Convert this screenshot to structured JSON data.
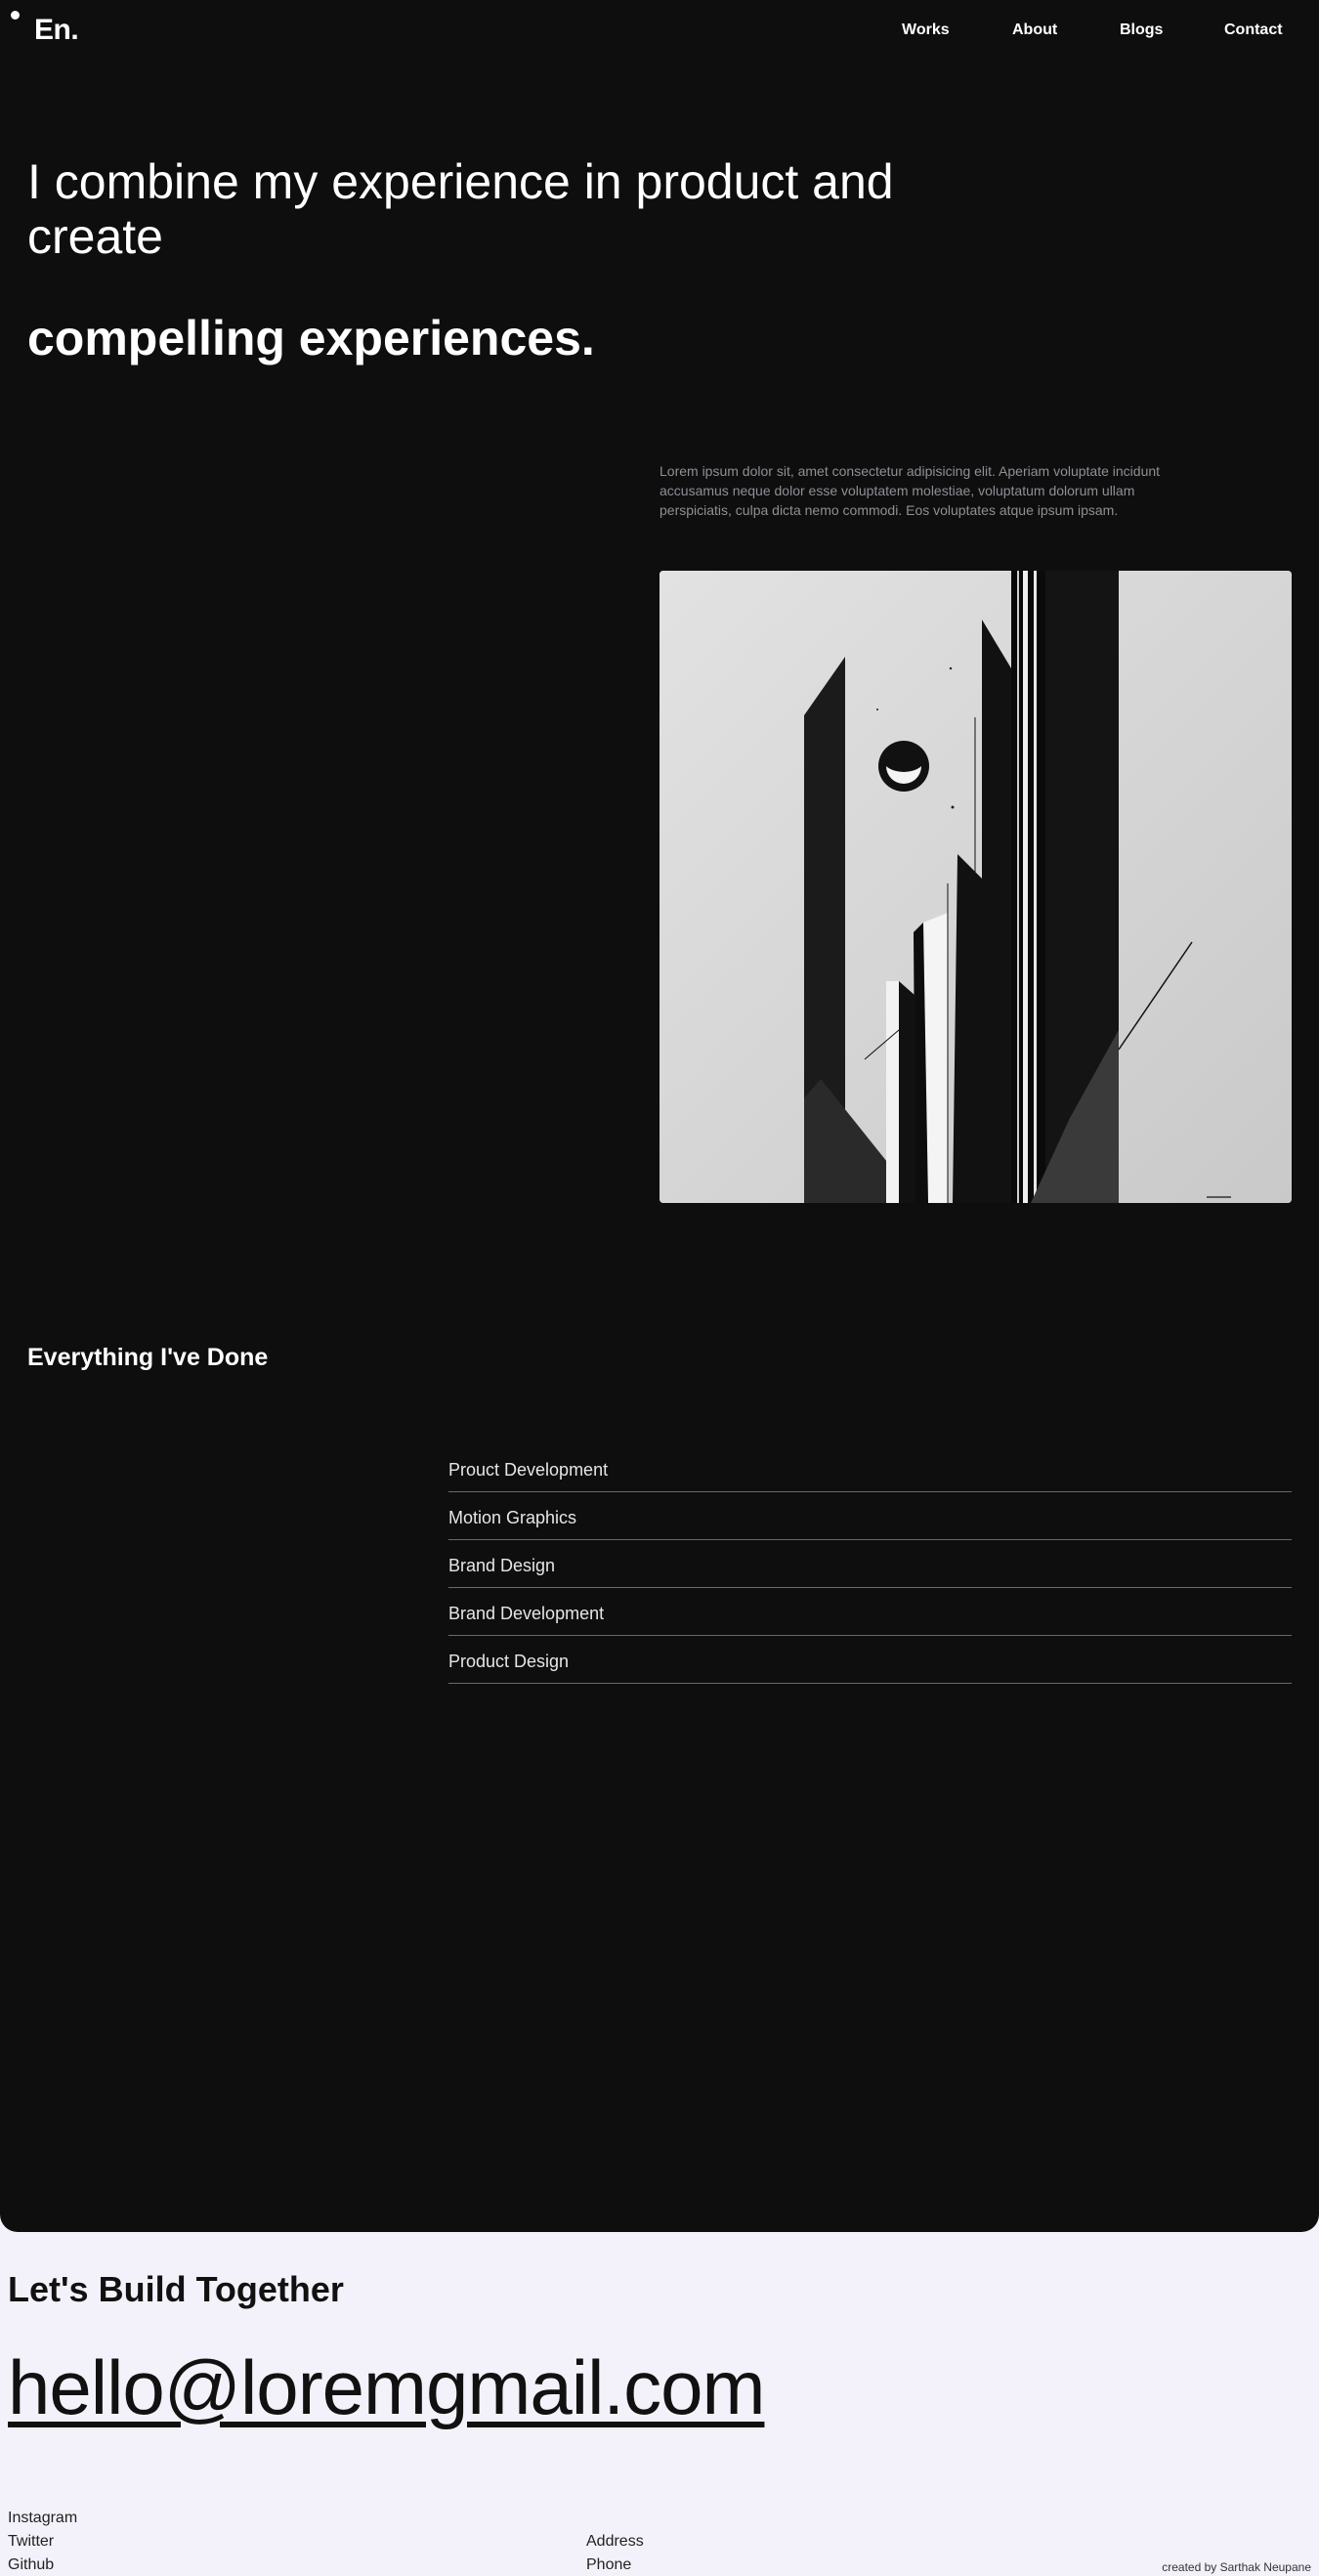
{
  "nav": {
    "logo": "En.",
    "works": "Works",
    "about": "About",
    "blogs": "Blogs",
    "contact": "Contact"
  },
  "hero": {
    "line1": "I combine my experience in product and create",
    "line2": "compelling experiences."
  },
  "intro": "Lorem ipsum dolor sit, amet consectetur adipisicing elit. Aperiam voluptate incidunt accusamus neque dolor esse voluptatem molestiae, voluptatum dolorum ullam perspiciatis, culpa dicta nemo commodi. Eos voluptates atque ipsum ipsam.",
  "services": {
    "title": "Everything I've Done",
    "items": [
      "Prouct Development",
      "Motion Graphics",
      "Brand Design",
      "Brand Development",
      "Product Design"
    ]
  },
  "footer": {
    "build": "Let's Build Together",
    "email": "hello@loremgmail.com",
    "social": [
      "Instagram",
      "Twitter",
      "Github"
    ],
    "contact": [
      "Address",
      "Phone"
    ],
    "credit": "created by Sarthak Neupane"
  },
  "colors": {
    "dark_bg": "#0e0e0f",
    "light_bg": "#f3f2fb"
  }
}
